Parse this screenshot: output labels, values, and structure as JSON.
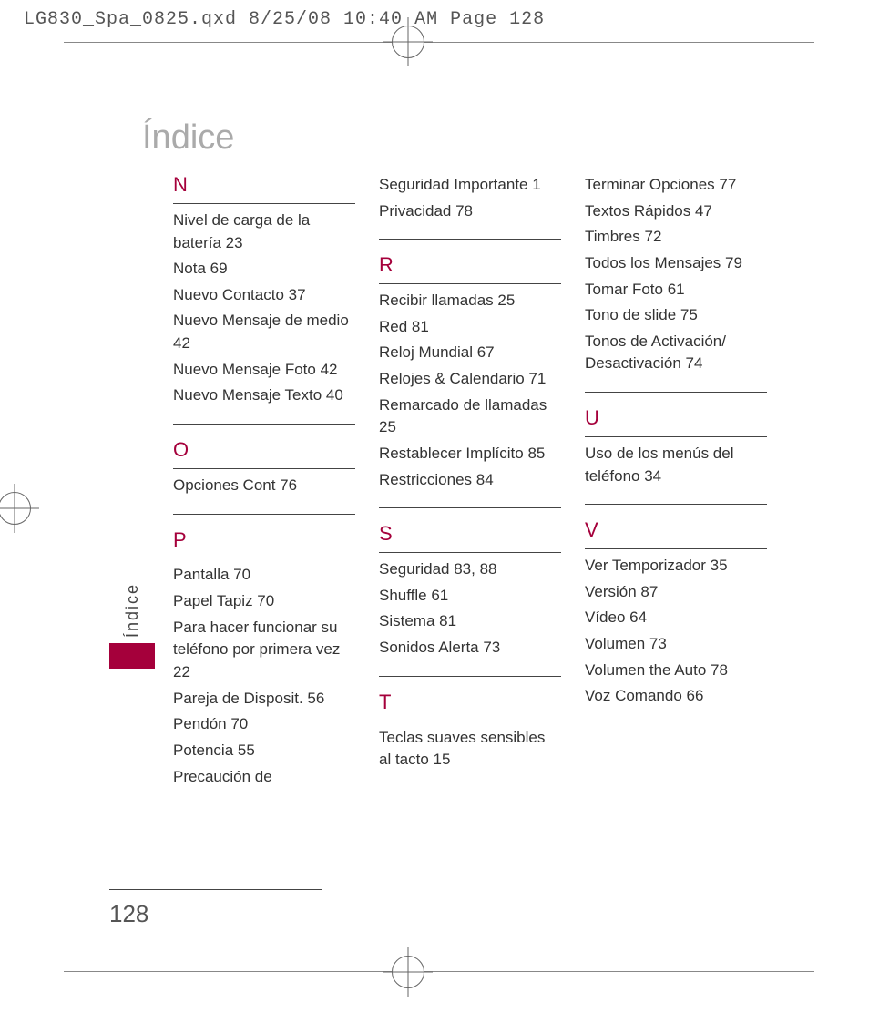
{
  "slug": "LG830_Spa_0825.qxd  8/25/08  10:40 AM  Page 128",
  "title": "Índice",
  "side_label": "Índice",
  "page_number": "128",
  "columns": [
    {
      "blocks": [
        {
          "letter": "N",
          "first": true,
          "entries": [
            "Nivel de carga de la batería 23",
            "Nota 69",
            "Nuevo Contacto 37",
            "Nuevo Mensaje de medio 42",
            "Nuevo Mensaje Foto 42",
            "Nuevo Mensaje Texto 40"
          ]
        },
        {
          "letter": "O",
          "entries": [
            "Opciones Cont 76"
          ]
        },
        {
          "letter": "P",
          "entries": [
            "Pantalla 70",
            "Papel Tapiz 70",
            "Para hacer funcionar su teléfono por primera vez 22",
            "Pareja de Disposit. 56",
            "Pendón 70",
            "Potencia 55",
            "Precaución de"
          ]
        }
      ]
    },
    {
      "lead_entries": [
        "Seguridad Importante 1",
        "Privacidad 78"
      ],
      "blocks": [
        {
          "letter": "R",
          "entries": [
            "Recibir llamadas 25",
            "Red 81",
            "Reloj Mundial 67",
            "Relojes & Calendario 71",
            "Remarcado de llamadas 25",
            "Restablecer Implícito 85",
            "Restricciones 84"
          ]
        },
        {
          "letter": "S",
          "entries": [
            "Seguridad 83, 88",
            "Shuffle 61",
            "Sistema 81",
            "Sonidos Alerta 73"
          ]
        },
        {
          "letter": "T",
          "entries": [
            "Teclas suaves sensibles al tacto 15"
          ]
        }
      ]
    },
    {
      "lead_entries": [
        "Terminar Opciones 77",
        "Textos Rápidos 47",
        "Timbres 72",
        "Todos los Mensajes 79",
        "Tomar Foto 61",
        "Tono de slide 75",
        "Tonos de Activación/ Desactivación 74"
      ],
      "blocks": [
        {
          "letter": "U",
          "entries": [
            "Uso de los menús del teléfono 34"
          ]
        },
        {
          "letter": "V",
          "entries": [
            "Ver Temporizador 35",
            "Versión 87",
            "Vídeo 64",
            "Volumen 73",
            "Volumen the Auto 78",
            "Voz Comando 66"
          ]
        }
      ]
    }
  ]
}
